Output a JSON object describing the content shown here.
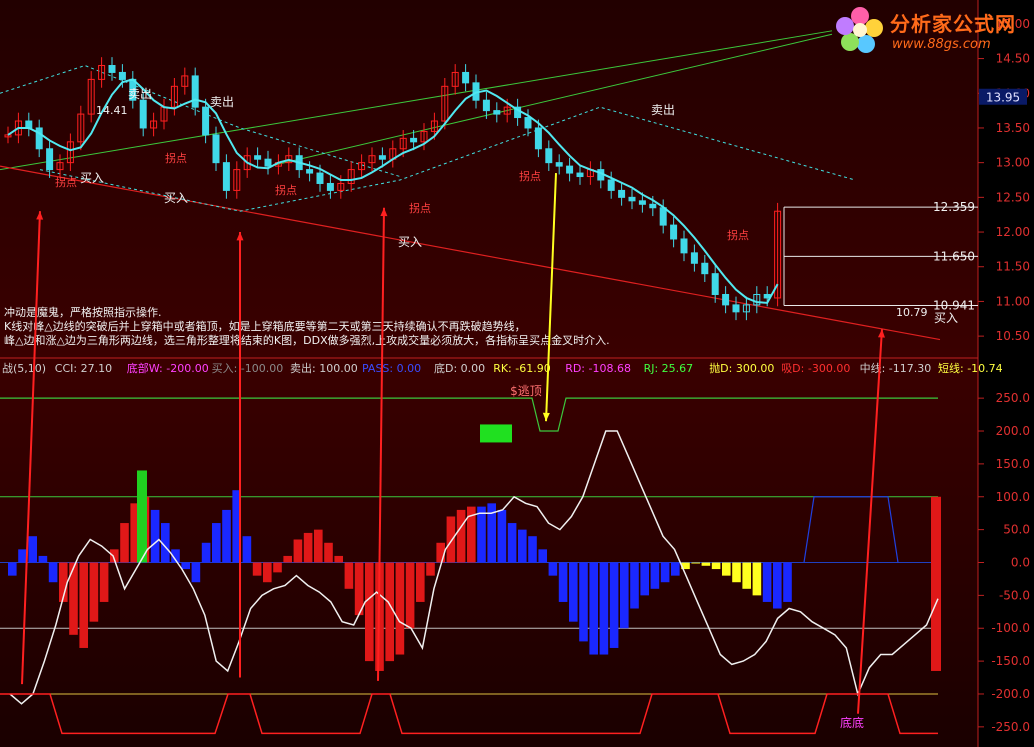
{
  "brand": {
    "name": "分析家公式网",
    "url": "www.88gs.com"
  },
  "price_panel": {
    "axis_ticks": [
      "15.00",
      "14.50",
      "14.00",
      "13.50",
      "13.00",
      "12.50",
      "12.00",
      "11.50",
      "11.00",
      "10.50"
    ],
    "current_price": "13.95",
    "box_labels": [
      "12.359",
      "11.650",
      "10.941"
    ],
    "note_lines": [
      "冲动是魔鬼，严格按照指示操作.",
      "K线对峰△边线的突破后并上穿箱中或者箱顶，如是上穿箱底要等第二天或第三天持续确认不再跌破趋势线，",
      "峰△边和涨△边为三角形两边线，选三角形整理将结束的K图，DDX做多强烈,上攻成交量必须放大，各指标呈买点金叉时介入."
    ],
    "labels": {
      "sell": "卖出",
      "buy": "买入",
      "turn": "拐点",
      "high": "14.41",
      "low": "10.79"
    }
  },
  "indicator_header": [
    {
      "text": "战(5,10)",
      "color": "#cfcfcf"
    },
    {
      "text": "CCI: 27.10",
      "color": "#cfcfcf"
    },
    {
      "text": "底部W: -200.00",
      "color": "#ff40ff"
    },
    {
      "text": "买入: -100.00",
      "color": "#8a8a8a"
    },
    {
      "text": "卖出: 100.00",
      "color": "#cfcfcf"
    },
    {
      "text": "PASS: 0.00",
      "color": "#3a4cff"
    },
    {
      "text": "底D: 0.00",
      "color": "#cfcfcf"
    },
    {
      "text": "RK: -61.90",
      "color": "#ffff40"
    },
    {
      "text": "RD: -108.68",
      "color": "#ff40ff"
    },
    {
      "text": "RJ: 25.67",
      "color": "#40ff40"
    },
    {
      "text": "抛D: 300.00",
      "color": "#ffff40"
    },
    {
      "text": "吸D: -300.00",
      "color": "#ff3030"
    },
    {
      "text": "中线: -117.30",
      "color": "#cfcfcf"
    },
    {
      "text": "短线: -10.74",
      "color": "#ffff40"
    }
  ],
  "indicator_labels": {
    "top": "$逃顶",
    "bottom": "底底"
  },
  "chart_data": [
    {
      "type": "candlestick",
      "title": "",
      "ylim": [
        10.3,
        15.2
      ],
      "y_ticks": [
        15.0,
        14.5,
        14.0,
        13.5,
        13.0,
        12.5,
        12.0,
        11.5,
        11.0,
        10.5
      ],
      "grid": false,
      "series": [
        {
          "name": "",
          "values": []
        }
      ]
    },
    {
      "type": "bar",
      "title": "",
      "ylim": [
        -270,
        270
      ],
      "y_ticks": [
        250,
        200,
        150,
        100,
        50,
        0,
        -50,
        -100,
        -150,
        -200,
        -250
      ],
      "reference_lines": [
        100,
        0,
        -100,
        -200
      ],
      "series": [
        {
          "name": "CCI",
          "values": [
            -200,
            -215,
            -200,
            -150,
            -95,
            -30,
            10,
            35,
            25,
            10,
            -40,
            -10,
            20,
            35,
            15,
            -10,
            -40,
            -80,
            -150,
            -165,
            -120,
            -70,
            -50,
            -40,
            -35,
            -20,
            -35,
            -45,
            -60,
            -90,
            -95,
            -60,
            -45,
            -60,
            -90,
            -100,
            -130,
            -40,
            20,
            45,
            70,
            75,
            75,
            80,
            100,
            90,
            85,
            60,
            50,
            70,
            100,
            150,
            200,
            200,
            160,
            120,
            80,
            40,
            20,
            -20,
            -60,
            -100,
            -140,
            -155,
            -150,
            -140,
            -120,
            -85,
            -70,
            -75,
            -90,
            -100,
            -110,
            -130,
            -200,
            -160,
            -140,
            -140,
            -125,
            -110,
            -95,
            -55
          ]
        }
      ]
    }
  ]
}
